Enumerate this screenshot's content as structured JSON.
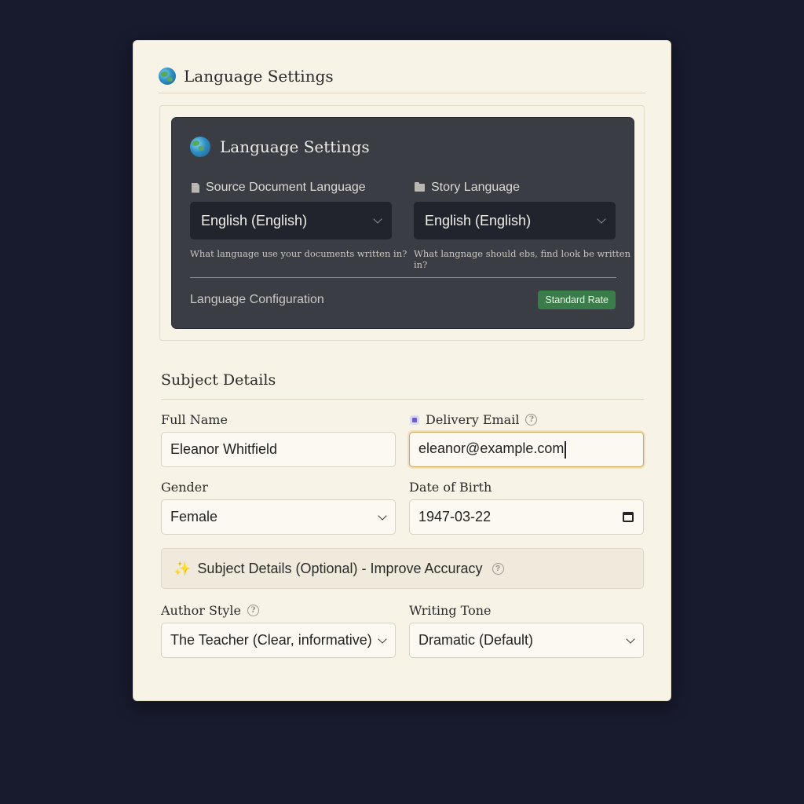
{
  "header": {
    "title": "Language Settings",
    "icon": "globe-icon"
  },
  "language_panel": {
    "title": "Language Settings",
    "source": {
      "label": "Source Document Language",
      "value": "English (English)",
      "hint": "What language use your documents written in?"
    },
    "story": {
      "label": "Story Language",
      "value": "English (English)",
      "hint": "What langnage should ebs, find look be written in?"
    },
    "config_label": "Language Configuration",
    "badge": "Standard Rate",
    "badge_color": "#3a7d4b"
  },
  "subject": {
    "title": "Subject Details",
    "full_name": {
      "label": "Full Name",
      "value": "Eleanor Whitfield"
    },
    "email": {
      "label": "Delivery Email",
      "value": "eleanor@example.com"
    },
    "gender": {
      "label": "Gender",
      "value": "Female"
    },
    "dob": {
      "label": "Date of Birth",
      "value": "1947-03-22"
    },
    "optional_label": "Subject Details (Optional) - Improve Accuracy",
    "author_style": {
      "label": "Author Style",
      "value": "The Teacher (Clear, informative)"
    },
    "writing_tone": {
      "label": "Writing Tone",
      "value": "Dramatic (Default)"
    }
  },
  "colors": {
    "background": "#181b2e",
    "card": "#f7f3e6",
    "dark_panel": "#3b3d45",
    "focus_accent": "#c9a85b"
  }
}
